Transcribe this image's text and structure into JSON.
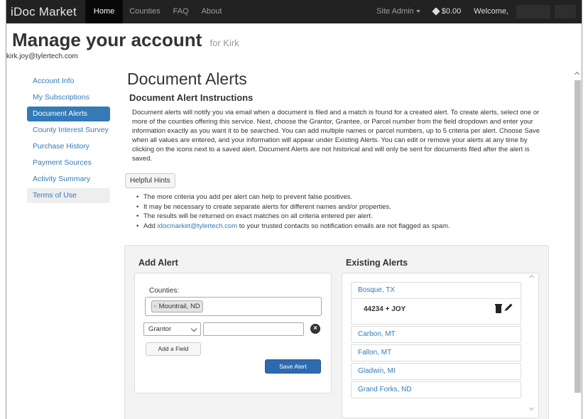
{
  "navbar": {
    "brand": "iDoc Market",
    "links": [
      "Home",
      "Counties",
      "FAQ",
      "About"
    ],
    "site_admin": "Site Admin",
    "balance": "$0.00",
    "welcome": "Welcome,"
  },
  "header": {
    "title": "Manage your account",
    "for_user": "for Kirk",
    "email": "kirk.joy@tylertech.com"
  },
  "sidebar": {
    "items": [
      {
        "label": "Account Info"
      },
      {
        "label": "My Subscriptions"
      },
      {
        "label": "Document Alerts"
      },
      {
        "label": "County Interest Survey"
      },
      {
        "label": "Purchase History"
      },
      {
        "label": "Payment Sources"
      },
      {
        "label": "Activity Summary"
      },
      {
        "label": "Terms of Use"
      }
    ]
  },
  "main": {
    "title": "Document Alerts",
    "instructions_title": "Document Alert Instructions",
    "instructions": "Document alerts will notify you via email when a document is filed and a match is found for a created alert. To create alerts, select one or more of the counties offering this service. Next, choose the Grantor, Grantee, or Parcel number from the field dropdown and enter your information exactly as you want it to be searched. You can add multiple names or parcel numbers, up to 5 criteria per alert. Choose Save when all values are entered, and your information will appear under Existing Alerts. You can edit or remove your alerts at any time by clicking on the icons next to a saved alert. Document Alerts are not historical and will only be sent for documents filed after the alert is saved.",
    "hints_button": "Helpful Hints",
    "hints": [
      "The more criteria you add per alert can help to prevent false positives.",
      "It may be necessary to create separate alerts for different names and/or properties.",
      "The results will be returned on exact matches on all criteria entered per alert."
    ],
    "hint_last_prefix": "Add ",
    "hint_last_link": "idocmarket@tylertech.com",
    "hint_last_suffix": " to your trusted contacts so notification emails are not flagged as spam."
  },
  "add_alert": {
    "title": "Add Alert",
    "counties_label": "Counties:",
    "selected_county": "Mountrail, ND",
    "chip_remove": "×",
    "field_select": "Grantor",
    "field_value": "",
    "remove_icon": "×",
    "add_field_button": "Add a Field",
    "save_button": "Save Alert"
  },
  "existing_alerts": {
    "title": "Existing Alerts",
    "items": [
      {
        "county": "Bosque, TX",
        "detail": "44234 + JOY"
      },
      {
        "county": "Carbon, MT"
      },
      {
        "county": "Fallon, MT"
      },
      {
        "county": "Gladwin, MI"
      },
      {
        "county": "Grand Forks, ND"
      }
    ]
  },
  "colors": {
    "navbar_bg": "#222222",
    "accent": "#337ab7",
    "save_button": "#2d6ab0"
  }
}
